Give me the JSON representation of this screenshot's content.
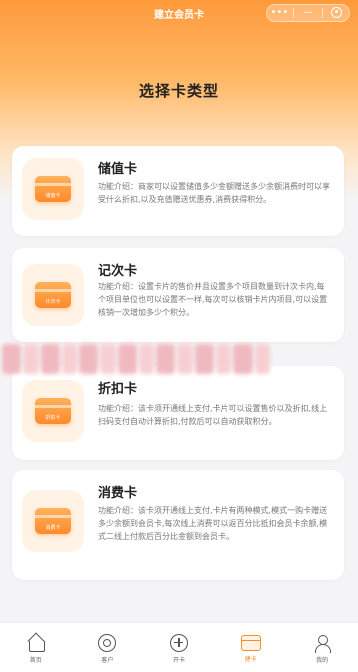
{
  "window": {
    "title": "建立会员卡"
  },
  "capsule": {
    "more": "•••",
    "minimize": "—"
  },
  "page": {
    "title": "选择卡类型"
  },
  "cards": [
    {
      "name": "储值卡",
      "icon_label": "储值卡",
      "desc": "功能介绍：商家可以设置储值多少金额赠送多少余额消费时可以享受什么折扣,以及充值赠送优惠券,消费获得积分。"
    },
    {
      "name": "记次卡",
      "icon_label": "计次卡",
      "desc": "功能介绍：设置卡片的售价并且设置多个项目数量到计次卡内,每个项目单位也可以设置不一样,每次可以核销卡片内项目,可以设置核销一次增加多少个积分。"
    },
    {
      "name": "折扣卡",
      "icon_label": "折扣卡",
      "desc": "功能介绍：该卡须开通线上支付,卡片可以设置售价以及折扣,线上扫码支付自动计算折扣,付款后可以自动获取积分。"
    },
    {
      "name": "消费卡",
      "icon_label": "消费卡",
      "desc": "功能介绍：该卡须开通线上支付,卡片有两种模式,模式一购卡赠送多少余额到会员卡,每次线上消费可以返百分比抵扣会员卡余额,模式二线上付款后百分比金额到会员卡。"
    }
  ],
  "tabbar": [
    {
      "label": "首页",
      "icon": "home-icon",
      "active": false
    },
    {
      "label": "客户",
      "icon": "customer-icon",
      "active": false
    },
    {
      "label": "开卡",
      "icon": "add-icon",
      "active": false
    },
    {
      "label": "建卡",
      "icon": "card-icon",
      "active": true
    },
    {
      "label": "我的",
      "icon": "user-icon",
      "active": false
    }
  ],
  "colors": {
    "accent": "#ff8a2a",
    "header": "#ff9a3c",
    "background": "#f4f4f6"
  }
}
